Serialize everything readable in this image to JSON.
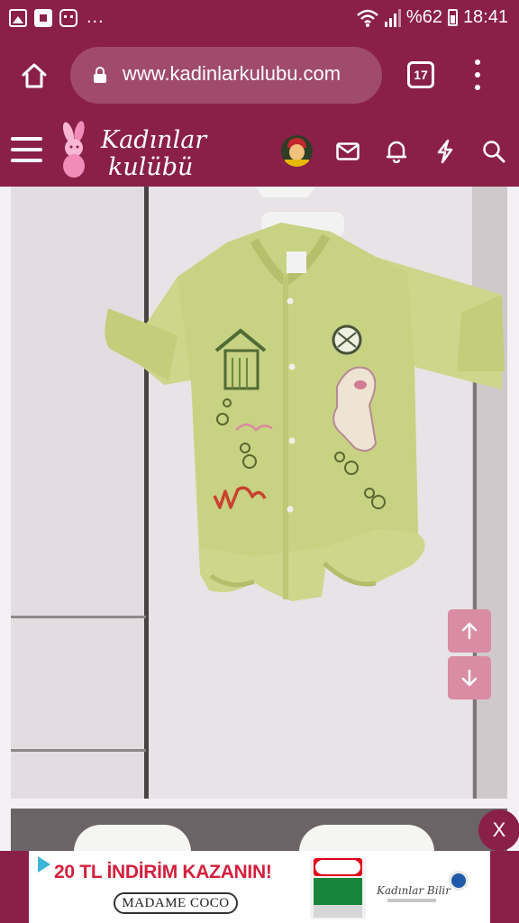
{
  "status_bar": {
    "more_indicator": "...",
    "battery_percent": "%62",
    "time": "18:41"
  },
  "browser": {
    "url": "www.kadinlarkulubu.com",
    "tab_count": "17"
  },
  "site_header": {
    "logo_line1": "Kadınlar",
    "logo_line2": "kulübü"
  },
  "ad": {
    "headline": "20 TL İNDİRİM KAZANIN!",
    "brand": "MADAME COCO",
    "sponsor": "Kadınlar Bilir"
  },
  "close_ad_label": "X",
  "icons": {
    "home": "home-icon",
    "lock": "lock-icon",
    "menu": "more-vert-icon",
    "hamburger": "menu-icon",
    "messages": "mail-icon",
    "notifications": "bell-icon",
    "activity": "lightning-icon",
    "search": "search-icon",
    "scroll_up": "arrow-up-icon",
    "scroll_down": "arrow-down-icon"
  },
  "colors": {
    "brand": "#8a1f48",
    "scroll_button": "#d98ca3",
    "ad_headline": "#d41f3c"
  }
}
